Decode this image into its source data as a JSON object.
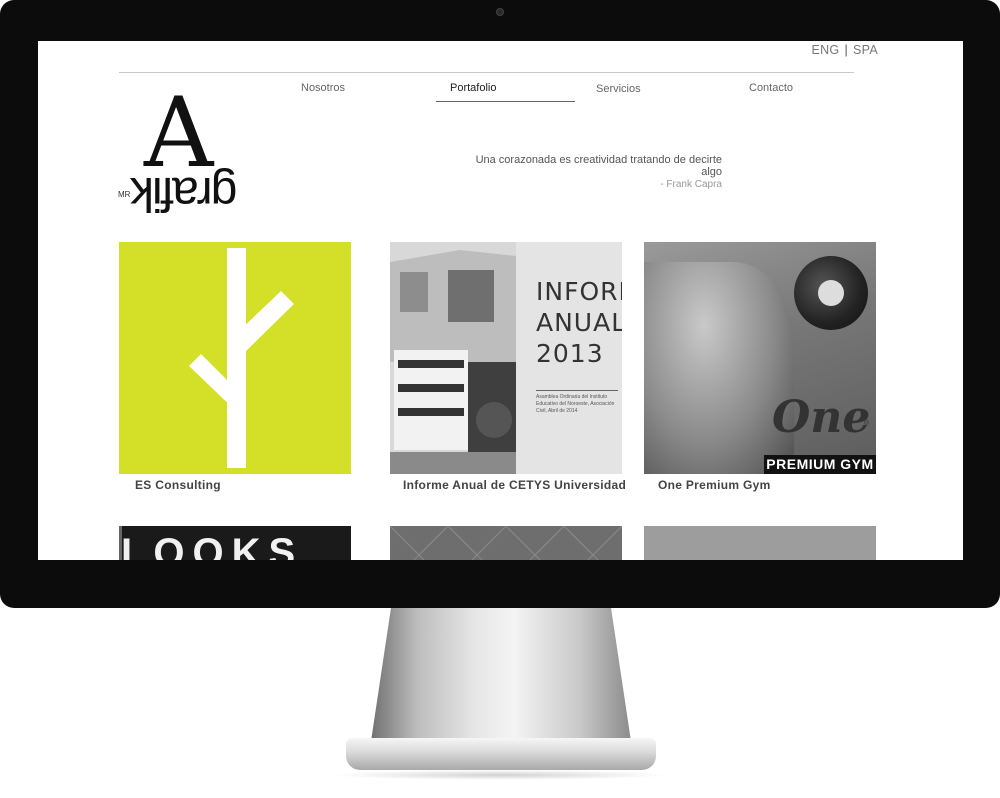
{
  "lang": {
    "eng": "ENG",
    "separator": "|",
    "spa": "SPA"
  },
  "nav": {
    "items": [
      "Nosotros",
      "Portafolio",
      "Servicios",
      "Contacto"
    ],
    "active": "Portafolio"
  },
  "logo": {
    "prefix": "MR",
    "letter": "A",
    "word": "grafik"
  },
  "quote": {
    "text": "Una corazonada es creatividad tratando de decirte algo",
    "author": "- Frank Capra"
  },
  "portfolio": {
    "items": [
      {
        "title": "ES Consulting",
        "color": "#d4df27"
      },
      {
        "title": "Informe Anual de CETYS Universidad",
        "cover_title_lines": [
          "INFORME",
          "ANUAL",
          "2013"
        ],
        "cover_small": "Asamblea Ordinaria del Instituto Educativo del Noroeste, Asociación Civil, Abril de 2014"
      },
      {
        "title": "One Premium Gym",
        "brand": "One",
        "registered": "®",
        "badge": "PREMIUM GYM"
      }
    ],
    "row2_partial": [
      {
        "visible_text": "LOOKS"
      }
    ]
  }
}
